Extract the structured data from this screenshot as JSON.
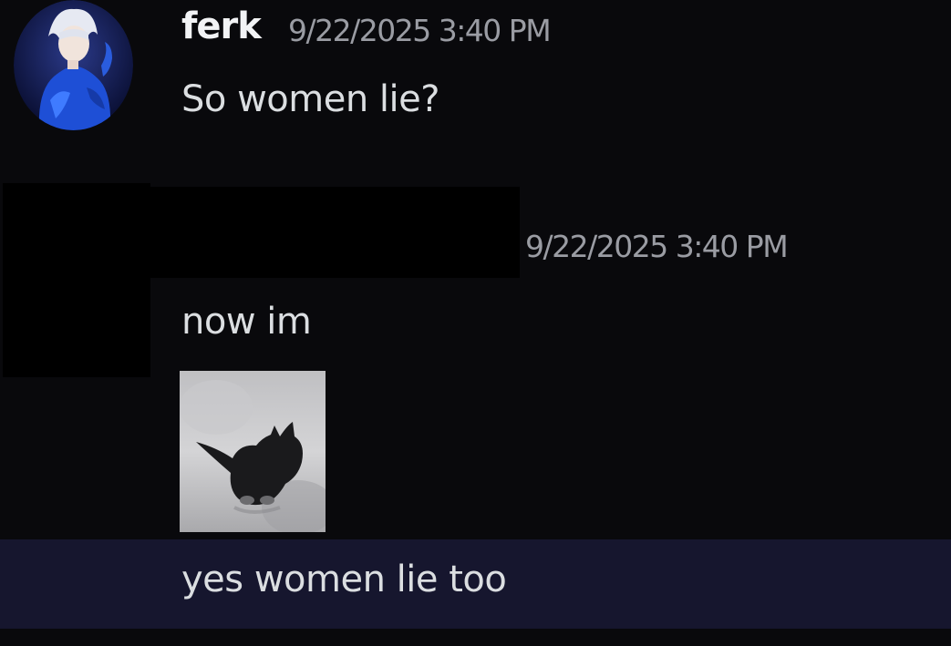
{
  "messages": [
    {
      "author": "ferk",
      "timestamp": "9/22/2025 3:40 PM",
      "text": "So women lie?"
    },
    {
      "author": "",
      "timestamp": "9/22/2025 3:40 PM",
      "text": "now im",
      "attachment": "black-kitten-gif"
    },
    {
      "author": "",
      "timestamp": "",
      "text": "yes women lie too"
    }
  ],
  "colors": {
    "background": "#09090c",
    "highlight": "#16162e",
    "username": "#f2f3f5",
    "timestamp": "#9a9ca3",
    "text": "#dbdee1"
  }
}
